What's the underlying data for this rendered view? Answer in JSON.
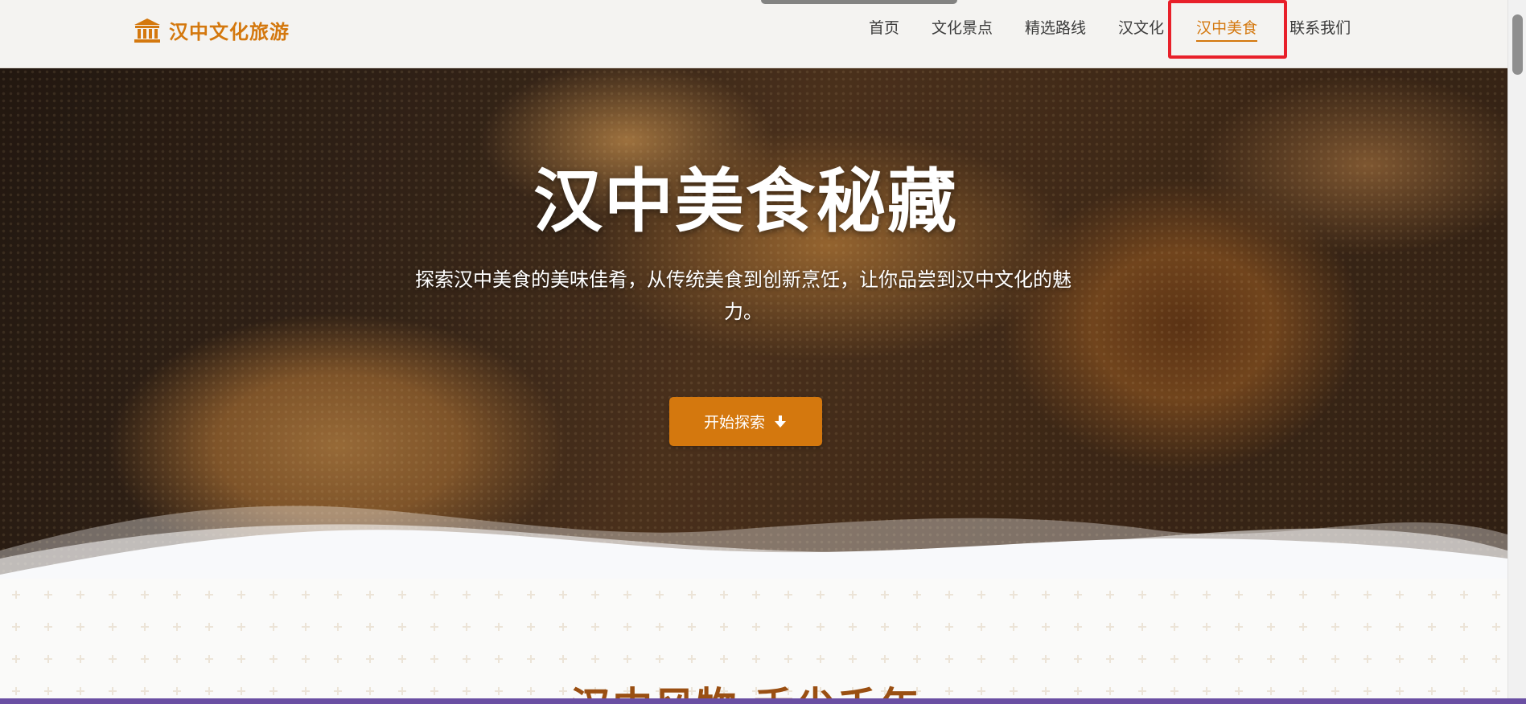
{
  "header": {
    "logo_icon": "temple-icon",
    "logo_text": "汉中文化旅游",
    "nav": [
      {
        "label": "首页",
        "active": false
      },
      {
        "label": "文化景点",
        "active": false
      },
      {
        "label": "精选路线",
        "active": false
      },
      {
        "label": "汉文化",
        "active": false
      },
      {
        "label": "汉中美食",
        "active": true
      },
      {
        "label": "联系我们",
        "active": false
      }
    ]
  },
  "hero": {
    "title": "汉中美食秘藏",
    "description": "探索汉中美食的美味佳肴，从传统美食到创新烹饪，让你品尝到汉中文化的魅力。",
    "button_label": "开始探索",
    "button_icon": "arrow-down-icon"
  },
  "section": {
    "title": "汉中风物·舌尖千年"
  },
  "colors": {
    "accent": "#d4780e",
    "highlight_box": "#e8202a",
    "section_title": "#9a4f12"
  }
}
